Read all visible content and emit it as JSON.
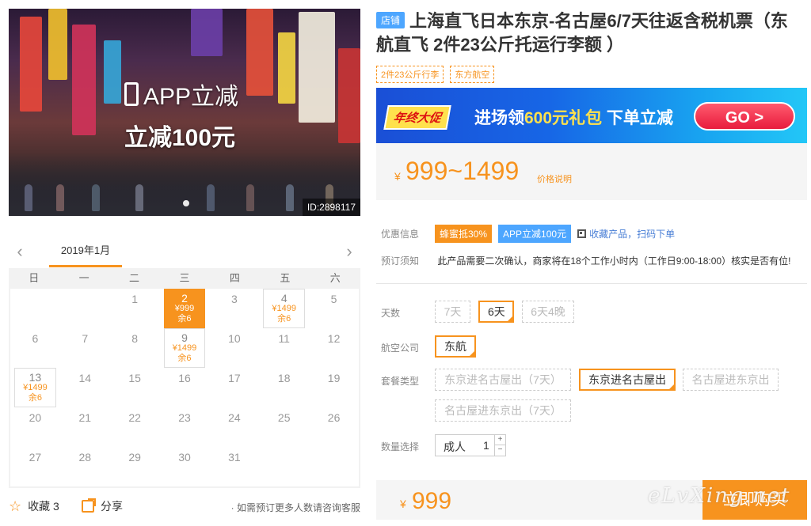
{
  "hero": {
    "promo_line1": "APP立减",
    "promo_line2": "立减100元",
    "image_id": "ID:2898117"
  },
  "calendar": {
    "month_label": "2019年1月",
    "prev_icon": "chevron-left-icon",
    "next_icon": "chevron-right-icon",
    "weekdays": [
      "日",
      "一",
      "二",
      "三",
      "四",
      "五",
      "六"
    ],
    "cells": [
      {
        "day": "",
        "price": "",
        "stock": ""
      },
      {
        "day": "",
        "price": "",
        "stock": ""
      },
      {
        "day": "1",
        "price": "",
        "stock": ""
      },
      {
        "day": "2",
        "price": "¥999",
        "stock": "余6",
        "selected": true
      },
      {
        "day": "3",
        "price": "",
        "stock": ""
      },
      {
        "day": "4",
        "price": "¥1499",
        "stock": "余6"
      },
      {
        "day": "5",
        "price": "",
        "stock": ""
      },
      {
        "day": "6",
        "price": "",
        "stock": ""
      },
      {
        "day": "7",
        "price": "",
        "stock": ""
      },
      {
        "day": "8",
        "price": "",
        "stock": ""
      },
      {
        "day": "9",
        "price": "¥1499",
        "stock": "余6"
      },
      {
        "day": "10",
        "price": "",
        "stock": ""
      },
      {
        "day": "11",
        "price": "",
        "stock": ""
      },
      {
        "day": "12",
        "price": "",
        "stock": ""
      },
      {
        "day": "13",
        "price": "¥1499",
        "stock": "余6"
      },
      {
        "day": "14",
        "price": "",
        "stock": ""
      },
      {
        "day": "15",
        "price": "",
        "stock": ""
      },
      {
        "day": "16",
        "price": "",
        "stock": ""
      },
      {
        "day": "17",
        "price": "",
        "stock": ""
      },
      {
        "day": "18",
        "price": "",
        "stock": ""
      },
      {
        "day": "19",
        "price": "",
        "stock": ""
      },
      {
        "day": "20",
        "price": "",
        "stock": ""
      },
      {
        "day": "21",
        "price": "",
        "stock": ""
      },
      {
        "day": "22",
        "price": "",
        "stock": ""
      },
      {
        "day": "23",
        "price": "",
        "stock": ""
      },
      {
        "day": "24",
        "price": "",
        "stock": ""
      },
      {
        "day": "25",
        "price": "",
        "stock": ""
      },
      {
        "day": "26",
        "price": "",
        "stock": ""
      },
      {
        "day": "27",
        "price": "",
        "stock": ""
      },
      {
        "day": "28",
        "price": "",
        "stock": ""
      },
      {
        "day": "29",
        "price": "",
        "stock": ""
      },
      {
        "day": "30",
        "price": "",
        "stock": ""
      },
      {
        "day": "31",
        "price": "",
        "stock": ""
      }
    ]
  },
  "actions": {
    "favorite_label": "收藏 3",
    "share_label": "分享",
    "tip": "· 如需预订更多人数请咨询客服"
  },
  "product": {
    "shop_badge": "店铺",
    "title": "上海直飞日本东京-名古屋6/7天往返含税机票（东航直飞 2件23公斤托运行李额 ）",
    "tags": [
      "2件23公斤行李",
      "东方航空"
    ]
  },
  "banner": {
    "ribbon": "年终大促",
    "text_pre": "进场领",
    "text_highlight": "600元礼包",
    "text_post": " 下单立减",
    "go_label": "GO >"
  },
  "price": {
    "currency": "¥",
    "range": "999~1499",
    "note": "价格说明"
  },
  "offers": {
    "label": "优惠信息",
    "items": [
      "蜂蜜抵30%",
      "APP立减100元"
    ],
    "qr_label": "收藏产品，扫码下单"
  },
  "notice": {
    "label": "预订须知",
    "text": "此产品需要二次确认，商家将在18个工作小时内（工作日9:00-18:00）核实是否有位!"
  },
  "options": {
    "days": {
      "label": "天数",
      "items": [
        "7天",
        "6天",
        "6天4晚"
      ],
      "selected": 1
    },
    "airline": {
      "label": "航空公司",
      "items": [
        "东航"
      ],
      "selected": 0
    },
    "package": {
      "label": "套餐类型",
      "items": [
        "东京进名古屋出（7天）",
        "东京进名古屋出",
        "名古屋进东京出",
        "名古屋进东京出（7天）"
      ],
      "selected": 1
    },
    "quantity": {
      "label": "数量选择",
      "type": "成人",
      "value": "1"
    }
  },
  "buy": {
    "currency": "¥",
    "price": "999",
    "button": "立即购买"
  },
  "watermark": "eLvXing.net",
  "colors": {
    "accent": "#f7931e",
    "blue": "#4da6ff"
  }
}
